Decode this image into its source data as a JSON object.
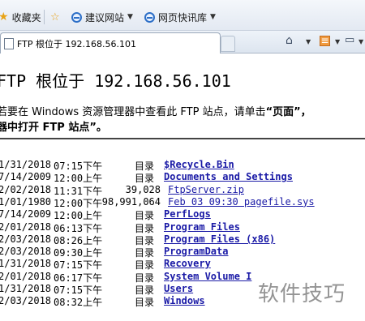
{
  "favorites_bar": {
    "favorites_label": "收藏夹",
    "items": [
      {
        "label": "建议网站",
        "icon": "ie-page-icon"
      },
      {
        "label": "网页快讯库",
        "icon": "ie-page-icon"
      }
    ]
  },
  "tab": {
    "title": "FTP 根位于 192.168.56.101"
  },
  "command_bar": {
    "home": "home-icon",
    "feeds": "rss-feed-icon",
    "print": "print-icon"
  },
  "page": {
    "heading": "FTP 根位于 192.168.56.101",
    "info_line1_prefix": "若要在 Windows 资源管理器中查看此 FTP 站点，请单击",
    "info_line1_strong": "“页面”，",
    "info_line2": "器中打开 FTP 站点”。"
  },
  "listing": [
    {
      "date": "1/31/2018",
      "time": "07:15下午",
      "kind": "目录",
      "size": "",
      "name": "$Recycle.Bin"
    },
    {
      "date": "7/14/2009",
      "time": "12:00上午",
      "kind": "目录",
      "size": "",
      "name": "Documents and Settings"
    },
    {
      "date": "2/02/2018",
      "time": "11:31下午",
      "kind": "",
      "size": "39,028",
      "name": "FtpServer.zip"
    },
    {
      "date": "1/01/1980",
      "time": "12:00下午",
      "kind": "",
      "size": "98,991,064",
      "name": "Feb 03 09:30 pagefile.sys"
    },
    {
      "date": "7/14/2009",
      "time": "12:00上午",
      "kind": "目录",
      "size": "",
      "name": "PerfLogs"
    },
    {
      "date": "2/01/2018",
      "time": "06:13下午",
      "kind": "目录",
      "size": "",
      "name": "Program Files"
    },
    {
      "date": "2/03/2018",
      "time": "08:26上午",
      "kind": "目录",
      "size": "",
      "name": "Program Files (x86)"
    },
    {
      "date": "2/03/2018",
      "time": "09:30上午",
      "kind": "目录",
      "size": "",
      "name": "ProgramData"
    },
    {
      "date": "1/31/2018",
      "time": "07:15下午",
      "kind": "目录",
      "size": "",
      "name": "Recovery"
    },
    {
      "date": "2/01/2018",
      "time": "06:17下午",
      "kind": "目录",
      "size": "",
      "name": "System Volume I"
    },
    {
      "date": "1/31/2018",
      "time": "07:15下午",
      "kind": "目录",
      "size": "",
      "name": "Users"
    },
    {
      "date": "2/03/2018",
      "time": "08:32上午",
      "kind": "目录",
      "size": "",
      "name": "Windows"
    }
  ],
  "watermark": "软件技巧",
  "colors": {
    "link": "#1a1aa6",
    "favorites_star": "#e8a317"
  }
}
